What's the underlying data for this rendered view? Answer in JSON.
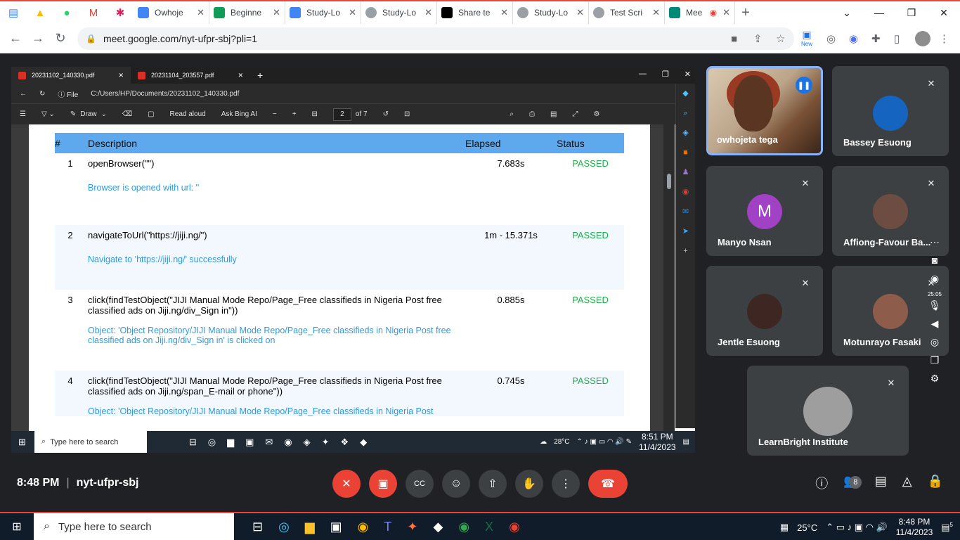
{
  "chrome": {
    "tabs": [
      {
        "label": "Owhoje",
        "color": "#4285f4"
      },
      {
        "label": "Beginne",
        "color": "#0f9d58"
      },
      {
        "label": "Study-Lo",
        "color": "#4285f4"
      },
      {
        "label": "Study-Lo",
        "color": "#5f6368"
      },
      {
        "label": "Share te",
        "color": "#000000"
      },
      {
        "label": "Study-Lo",
        "color": "#5f6368"
      },
      {
        "label": "Test Scri",
        "color": "#5f6368"
      },
      {
        "label": "Mee",
        "color": "#00897b"
      }
    ],
    "url": "meet.google.com/nyt-ufpr-sbj?pli=1",
    "new_badge": "New"
  },
  "pdf": {
    "tabs": [
      "20231102_140330.pdf",
      "20231104_203557.pdf"
    ],
    "file_label": "File",
    "path": "C:/Users/HP/Documents/20231102_140330.pdf",
    "toolbar": {
      "draw": "Draw",
      "read_aloud": "Read aloud",
      "ask_bing": "Ask Bing AI",
      "page": "2",
      "of_pages": "of 7"
    },
    "table": {
      "headers": [
        "#",
        "Description",
        "Elapsed",
        "Status"
      ],
      "rows": [
        {
          "num": "1",
          "desc": "openBrowser(\"\")",
          "elapsed": "7.683s",
          "status": "PASSED",
          "msg": "Browser is opened with url: ''"
        },
        {
          "num": "2",
          "desc": "navigateToUrl(\"https://jiji.ng/\")",
          "elapsed": "1m - 15.371s",
          "status": "PASSED",
          "msg": "Navigate to 'https://jiji.ng/' successfully"
        },
        {
          "num": "3",
          "desc": "click(findTestObject(\"JIJI Manual Mode Repo/Page_Free classifieds in Nigeria  Post free classified ads on Jiji.ng/div_Sign in\"))",
          "elapsed": "0.885s",
          "status": "PASSED",
          "msg": "Object: 'Object Repository/JIJI Manual Mode Repo/Page_Free classifieds in Nigeria  Post free classified ads on Jiji.ng/div_Sign in' is clicked on"
        },
        {
          "num": "4",
          "desc": "click(findTestObject(\"JIJI Manual Mode Repo/Page_Free classifieds in Nigeria  Post free classified ads on Jiji.ng/span_E-mail or phone\"))",
          "elapsed": "0.745s",
          "status": "PASSED",
          "msg": "Object: 'Object Repository/JIJI Manual Mode Repo/Page_Free classifieds in Nigeria  Post"
        }
      ]
    },
    "inner_taskbar": {
      "search": "Type here to search",
      "weather": "28°C",
      "time": "8:51 PM",
      "date": "11/4/2023"
    }
  },
  "participants": [
    {
      "name": "owhojeta tega",
      "speaking": true
    },
    {
      "name": "Bassey Esuong",
      "avatar_color": "#1565c0"
    },
    {
      "name": "Manyo Nsan",
      "initial": "M",
      "avatar_color": "#a142c4"
    },
    {
      "name": "Affiong-Favour Ba...",
      "avatar_color": "#6d4c41"
    },
    {
      "name": "Jentle Esuong",
      "avatar_color": "#3e2723"
    },
    {
      "name": "Motunrayo Fasaki",
      "avatar_color": "#8d5c4a"
    },
    {
      "name": "LearnBright Institute",
      "avatar_color": "#9e9e9e"
    }
  ],
  "side": {
    "time": "25:05"
  },
  "meeting": {
    "time": "8:48 PM",
    "code": "nyt-ufpr-sbj",
    "participant_count": "8"
  },
  "taskbar": {
    "search": "Type here to search",
    "weather": "25°C",
    "time": "8:48 PM",
    "date": "11/4/2023",
    "notif": "5"
  }
}
